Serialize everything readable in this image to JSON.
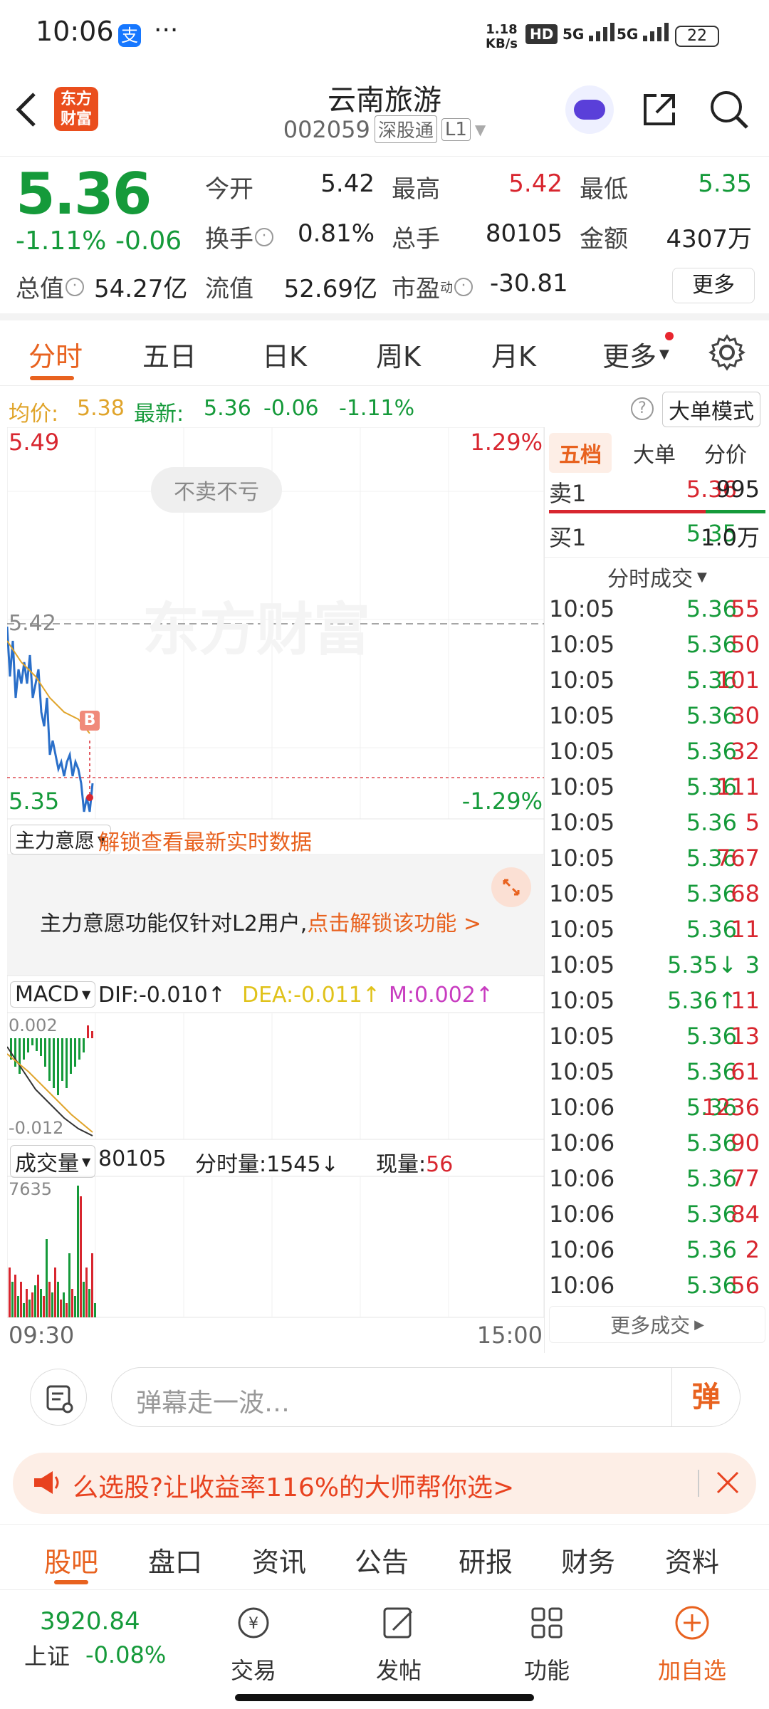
{
  "status_bar": {
    "time": "10:06",
    "net_speed_top": "1.18",
    "net_speed_bottom": "KB/s",
    "hd": "HD",
    "sig1": "5G",
    "sig2": "5G",
    "battery": "22"
  },
  "header": {
    "logo_line1": "东方",
    "logo_line2": "财富",
    "name": "云南旅游",
    "code": "002059",
    "tag1": "深股通",
    "tag2": "L1"
  },
  "quote": {
    "price": "5.36",
    "change_pct": "-1.11%",
    "change": "-0.06",
    "open_label": "今开",
    "open": "5.42",
    "high_label": "最高",
    "high": "5.42",
    "low_label": "最低",
    "low": "5.35",
    "turnover_label": "换手",
    "turnover": "0.81%",
    "vol_label": "总手",
    "vol": "80105",
    "amount_label": "金额",
    "amount": "4307万",
    "mcap_label": "总值",
    "mcap": "54.27亿",
    "float_label": "流值",
    "float": "52.69亿",
    "pe_label": "市盈",
    "pe_sup": "动",
    "pe": "-30.81",
    "more": "更多"
  },
  "chart_tabs": [
    "分时",
    "五日",
    "日K",
    "周K",
    "月K",
    "更多"
  ],
  "avg_row": {
    "avg_label": "均价:",
    "avg": "5.38",
    "last_label": "最新:",
    "last": "5.36",
    "chg": "-0.06",
    "pct": "-1.11%",
    "mode": "大单模式"
  },
  "chart": {
    "max_price": "5.49",
    "max_pct": "1.29%",
    "min_price": "5.35",
    "min_pct": "-1.29%",
    "ref_price": "5.42",
    "bubble": "不卖不亏",
    "watermark": "东方财富",
    "b_marker": "B",
    "zl_label": "主力意愿",
    "zl_unlock": "解锁查看最新实时数据",
    "zl_msg": "主力意愿功能仅针对L2用户,",
    "zl_link": "点击解锁该功能 >",
    "macd_label": "MACD",
    "dif": "DIF:-0.010↑",
    "dea": "DEA:-0.011↑",
    "m": "M:0.002↑",
    "macd_top": "0.002",
    "macd_bottom": "-0.012",
    "vol_label": "成交量",
    "vol_total": "80105",
    "vol_min": "分时量:1545↓",
    "vol_now_label": "现量:",
    "vol_now": "56",
    "vol_max": "7635",
    "time_start": "09:30",
    "time_end": "15:00"
  },
  "orderbook": {
    "tabs": [
      "五档",
      "大单",
      "分价"
    ],
    "sell_label": "卖1",
    "sell_price": "5.36",
    "sell_vol": "995",
    "buy_label": "买1",
    "buy_price": "5.35",
    "buy_vol": "1.0万",
    "trades_title": "分时成交",
    "trades": [
      [
        "10:05",
        "5.36",
        "55",
        "r"
      ],
      [
        "10:05",
        "5.36",
        "50",
        "r"
      ],
      [
        "10:05",
        "5.36",
        "101",
        "r"
      ],
      [
        "10:05",
        "5.36",
        "30",
        "r"
      ],
      [
        "10:05",
        "5.36",
        "32",
        "r"
      ],
      [
        "10:05",
        "5.36",
        "111",
        "r"
      ],
      [
        "10:05",
        "5.36",
        "5",
        "r"
      ],
      [
        "10:05",
        "5.36",
        "767",
        "r"
      ],
      [
        "10:05",
        "5.36",
        "68",
        "r"
      ],
      [
        "10:05",
        "5.36",
        "11",
        "r"
      ],
      [
        "10:05",
        "5.35↓",
        "3",
        "g"
      ],
      [
        "10:05",
        "5.36↑",
        "11",
        "r"
      ],
      [
        "10:05",
        "5.36",
        "13",
        "r"
      ],
      [
        "10:05",
        "5.36",
        "61",
        "r"
      ],
      [
        "10:06",
        "5.36",
        "1236",
        "r"
      ],
      [
        "10:06",
        "5.36",
        "90",
        "r"
      ],
      [
        "10:06",
        "5.36",
        "77",
        "r"
      ],
      [
        "10:06",
        "5.36",
        "84",
        "r"
      ],
      [
        "10:06",
        "5.36",
        "2",
        "r"
      ],
      [
        "10:06",
        "5.36",
        "56",
        "r"
      ]
    ],
    "more_trades": "更多成交"
  },
  "danmu": {
    "placeholder": "弹幕走一波…",
    "btn": "弹"
  },
  "banner": {
    "text": "么选股?让收益率116%的大师帮你选>"
  },
  "bottom_tabs": [
    "股吧",
    "盘口",
    "资讯",
    "公告",
    "研报",
    "财务",
    "资料"
  ],
  "nav": {
    "index_value": "3920.84",
    "index_name": "上证",
    "index_chg": "-0.08%",
    "trade": "交易",
    "post": "发帖",
    "func": "功能",
    "add": "加自选"
  }
}
